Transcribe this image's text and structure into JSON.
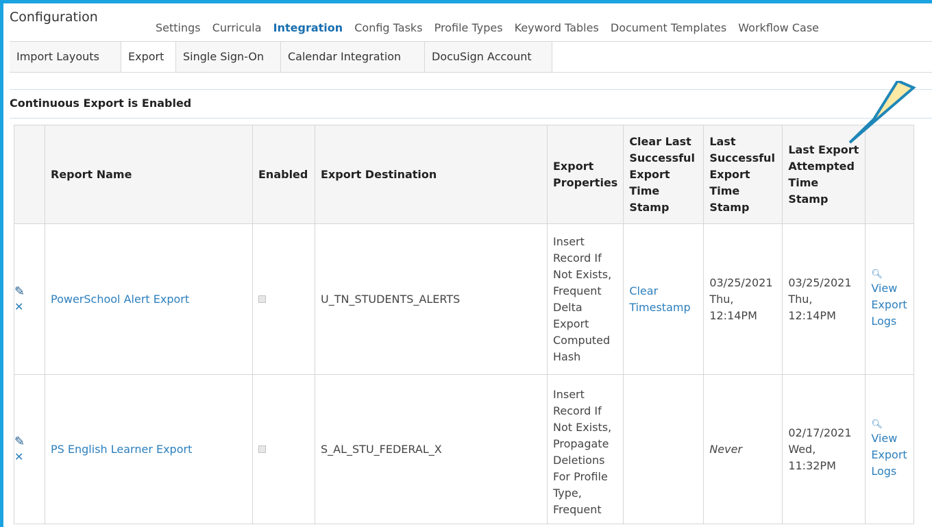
{
  "app": {
    "title": "Configuration"
  },
  "top_tabs": [
    {
      "label": "Settings",
      "active": false
    },
    {
      "label": "Curricula",
      "active": false
    },
    {
      "label": "Integration",
      "active": true
    },
    {
      "label": "Config Tasks",
      "active": false
    },
    {
      "label": "Profile Types",
      "active": false
    },
    {
      "label": "Keyword Tables",
      "active": false
    },
    {
      "label": "Document Templates",
      "active": false
    },
    {
      "label": "Workflow Case",
      "active": false
    }
  ],
  "sub_tabs": [
    {
      "label": "Import Layouts",
      "active": false
    },
    {
      "label": "Export",
      "active": true
    },
    {
      "label": "Single Sign-On",
      "active": false
    },
    {
      "label": "Calendar Integration",
      "active": false
    },
    {
      "label": "DocuSign Account",
      "active": false
    }
  ],
  "section": {
    "title": "Continuous Export is Enabled"
  },
  "table": {
    "headers": [
      "",
      "Report Name",
      "Enabled",
      "Export Destination",
      "Export Properties",
      "Clear Last Successful Export Time Stamp",
      "Last Successful Export Time Stamp",
      "Last Export Attempted Time Stamp",
      ""
    ],
    "rows": [
      {
        "report_name": "PowerSchool Alert Export",
        "enabled": false,
        "destination": "U_TN_STUDENTS_ALERTS",
        "properties": "Insert Record If Not Exists, Frequent Delta Export Computed Hash",
        "clear_link": "Clear Timestamp",
        "last_success": "03/25/2021 Thu, 12:14PM",
        "last_attempt": "03/25/2021 Thu, 12:14PM",
        "logs_link": "View Export Logs"
      },
      {
        "report_name": "PS English Learner Export",
        "enabled": false,
        "destination": "S_AL_STU_FEDERAL_X",
        "properties": "Insert Record If Not Exists, Propagate Deletions For Profile Type, Frequent",
        "clear_link": "",
        "last_success": "Never",
        "last_attempt": "02/17/2021 Wed, 11:32PM",
        "logs_link": "View Export Logs"
      }
    ]
  },
  "icons": {
    "edit": "pencil-icon",
    "delete": "close-icon",
    "view": "magnifier-icon"
  },
  "colors": {
    "frame_border": "#1aa3e0",
    "link": "#2c7fbd",
    "active_tab": "#1a6fb0",
    "callout_fill": "#fbe9a6",
    "callout_stroke": "#1f87b8"
  }
}
